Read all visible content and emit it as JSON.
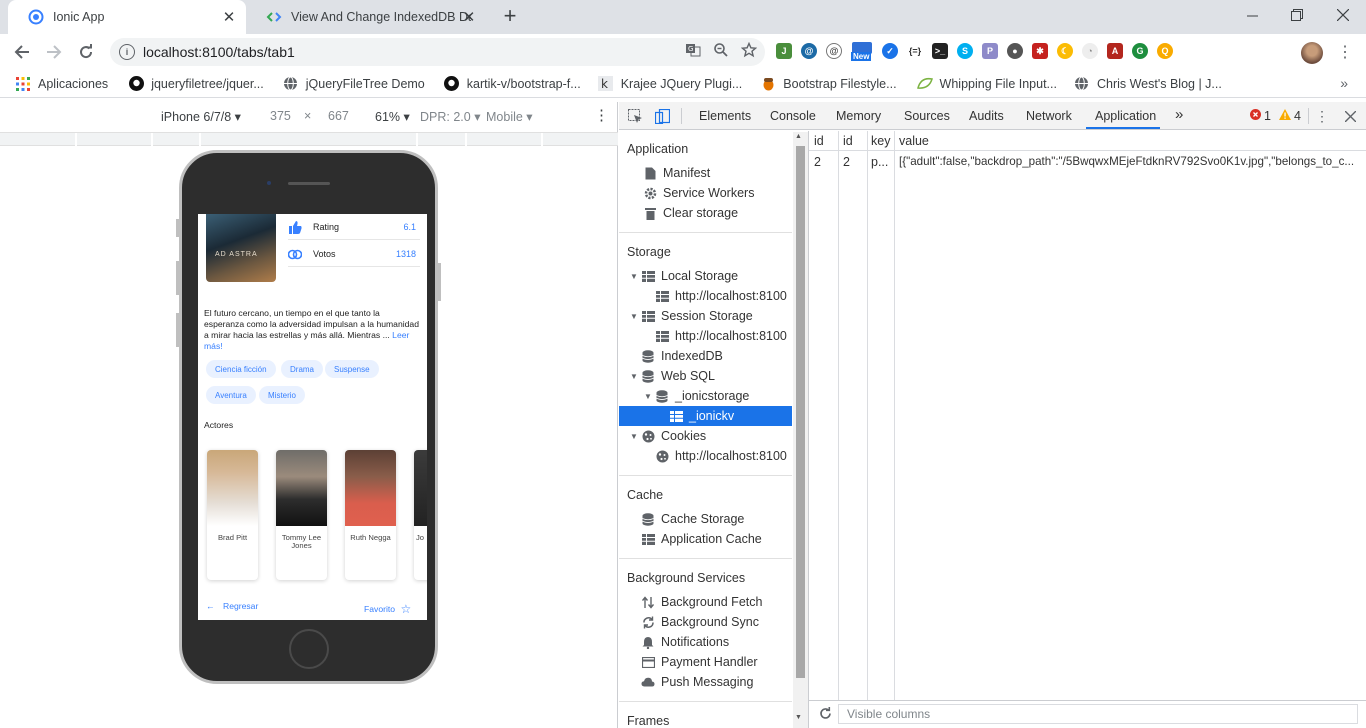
{
  "tabs": [
    {
      "title": "Ionic App",
      "active": true
    },
    {
      "title": "View And Change IndexedDB Da",
      "active": false
    }
  ],
  "toolbar": {
    "url": "localhost:8100/tabs/tab1",
    "new_badge": "New"
  },
  "bookmarks": [
    {
      "label": "Aplicaciones",
      "icon": "apps-grid-icon"
    },
    {
      "label": "jqueryfiletree/jquer...",
      "icon": "github-icon"
    },
    {
      "label": "jQueryFileTree Demo",
      "icon": "globe-icon"
    },
    {
      "label": "kartik-v/bootstrap-f...",
      "icon": "github-icon"
    },
    {
      "label": "Krajee JQuery Plugi...",
      "icon": "krajee-icon"
    },
    {
      "label": "Bootstrap Filestyle...",
      "icon": "acorn-icon"
    },
    {
      "label": "Whipping File Input...",
      "icon": "leaf-icon"
    },
    {
      "label": "Chris West's Blog | J...",
      "icon": "globe-icon"
    }
  ],
  "device_bar": {
    "device": "iPhone 6/7/8",
    "width": "375",
    "times": "×",
    "height": "667",
    "zoom": "61%",
    "dpr": "DPR: 2.0",
    "mode": "Mobile"
  },
  "app_screen": {
    "poster_text": "AD ASTRA",
    "stats": [
      {
        "label": "Rating",
        "value": "6.1"
      },
      {
        "label": "Votos",
        "value": "1318"
      }
    ],
    "overview": "El futuro cercano, un tiempo en el que tanto la esperanza como la adversidad impulsan a la humanidad a mirar hacia las estrellas y más allá. Mientras ...",
    "read_more": "Leer más!",
    "genres": [
      "Ciencia ficción",
      "Drama",
      "Suspense",
      "Aventura",
      "Misterio"
    ],
    "actors_title": "Actores",
    "actors": [
      "Brad Pitt",
      "Tommy Lee Jones",
      "Ruth Negga",
      "Jo"
    ],
    "back_label": "Regresar",
    "favorite_label": "Favorito"
  },
  "devtools": {
    "tabs": [
      "Elements",
      "Console",
      "Memory",
      "Sources",
      "Audits",
      "Network",
      "Application"
    ],
    "active_tab": "Application",
    "more_tabs": "»",
    "errors": "1",
    "warnings": "4",
    "sidebar": {
      "application_title": "Application",
      "application_items": [
        "Manifest",
        "Service Workers",
        "Clear storage"
      ],
      "storage_title": "Storage",
      "local_storage": "Local Storage",
      "local_storage_origin": "http://localhost:8100",
      "session_storage": "Session Storage",
      "session_storage_origin": "http://localhost:8100",
      "indexeddb": "IndexedDB",
      "web_sql": "Web SQL",
      "ionicstorage": "_ionicstorage",
      "ionickv": "_ionickv",
      "cookies": "Cookies",
      "cookies_origin": "http://localhost:8100",
      "cache_title": "Cache",
      "cache_items": [
        "Cache Storage",
        "Application Cache"
      ],
      "background_title": "Background Services",
      "background_items": [
        "Background Fetch",
        "Background Sync",
        "Notifications",
        "Payment Handler",
        "Push Messaging"
      ],
      "frames_title": "Frames"
    },
    "grid": {
      "columns": [
        "id",
        "id",
        "key",
        "value"
      ],
      "rows": [
        [
          "2",
          "2",
          "p...",
          "[{\"adult\":false,\"backdrop_path\":\"/5BwqwxMEjeFtdknRV792Svo0K1v.jpg\",\"belongs_to_c..."
        ]
      ]
    },
    "footer_placeholder": "Visible columns"
  },
  "colors": {
    "accent": "#1a73e8",
    "ionic_primary": "#3880ff",
    "error": "#d93025",
    "warning": "#f9ab00"
  }
}
